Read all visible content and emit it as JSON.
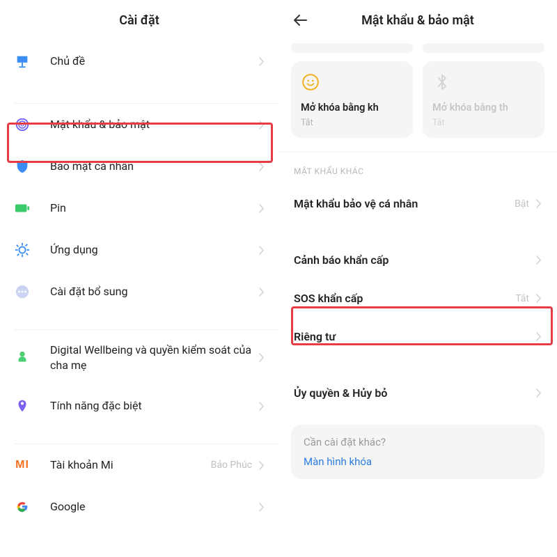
{
  "left": {
    "title": "Cài đặt",
    "items": [
      {
        "icon": "theme",
        "label": "Chủ đề"
      },
      {
        "icon": "fingerprint",
        "label": "Mật khẩu & bảo mật",
        "highlight": true
      },
      {
        "icon": "shield",
        "label": "Bảo mật cá nhân"
      },
      {
        "icon": "battery",
        "label": "Pin"
      },
      {
        "icon": "apps",
        "label": "Ứng dụng"
      },
      {
        "icon": "dots",
        "label": "Cài đặt bổ sung"
      },
      {
        "icon": "wellbeing",
        "label": "Digital Wellbeing và quyền kiểm soát của cha mẹ"
      },
      {
        "icon": "special",
        "label": "Tính năng đặc biệt"
      },
      {
        "icon": "mi",
        "label": "Tài khoản Mi",
        "value": "Bảo Phúc"
      },
      {
        "icon": "google",
        "label": "Google"
      }
    ]
  },
  "right": {
    "title": "Mật khẩu & bảo mật",
    "cards": [
      {
        "icon": "smile",
        "title": "Mở khóa bằng kh",
        "status": "Tắt"
      },
      {
        "icon": "bluetooth",
        "title": "Mở khóa bằng th",
        "status": "Tắt",
        "dim": true
      }
    ],
    "section_head": "MẬT KHẨU KHÁC",
    "rows": [
      {
        "label": "Mật khẩu bảo vệ cá nhân",
        "value": "Bật"
      },
      {
        "label": "Cảnh báo khẩn cấp"
      },
      {
        "label": "SOS khẩn cấp",
        "value": "Tắt",
        "highlight": true
      },
      {
        "label": "Riêng tư"
      },
      {
        "label": "Ủy quyền & Hủy bỏ"
      }
    ],
    "footer": {
      "question": "Cần cài đặt khác?",
      "link": "Màn hình khóa"
    }
  }
}
